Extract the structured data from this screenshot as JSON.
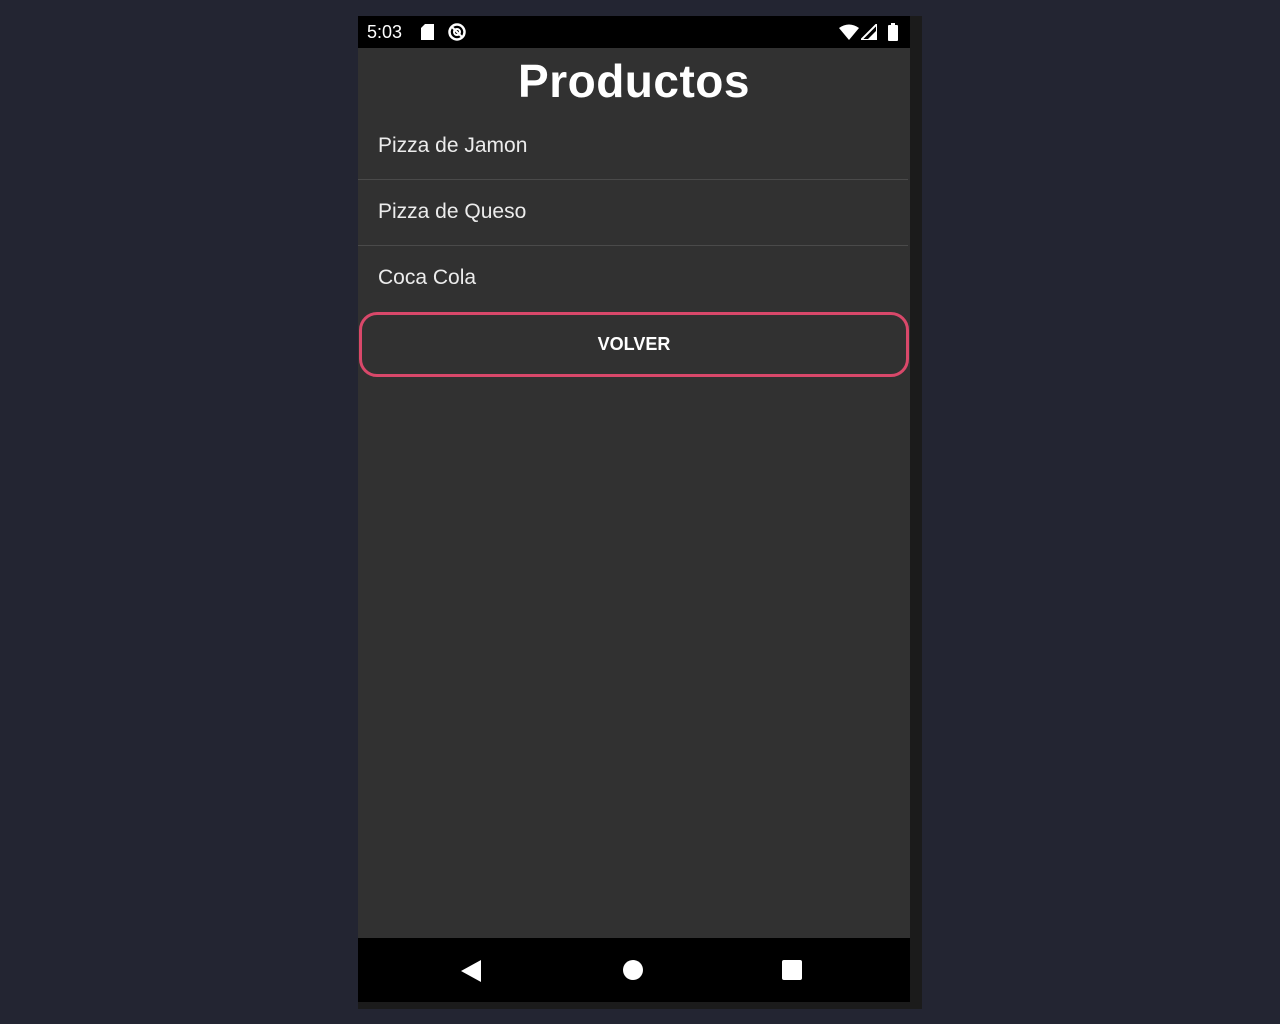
{
  "status_bar": {
    "time": "5:03",
    "icons": [
      "sd-card-icon",
      "sync-icon",
      "wifi-icon",
      "signal-icon",
      "battery-icon"
    ]
  },
  "screen": {
    "title": "Productos",
    "products": [
      {
        "label": "Pizza de Jamon"
      },
      {
        "label": "Pizza de Queso"
      },
      {
        "label": "Coca Cola"
      }
    ],
    "back_button_label": "VOLVER"
  },
  "nav_bar": {
    "icons": [
      "back-triangle-icon",
      "home-circle-icon",
      "recents-square-icon"
    ]
  },
  "colors": {
    "background": "#232532",
    "screen": "#313131",
    "bars": "#000000",
    "button_border": "#d9486a",
    "text": "#ffffff"
  }
}
